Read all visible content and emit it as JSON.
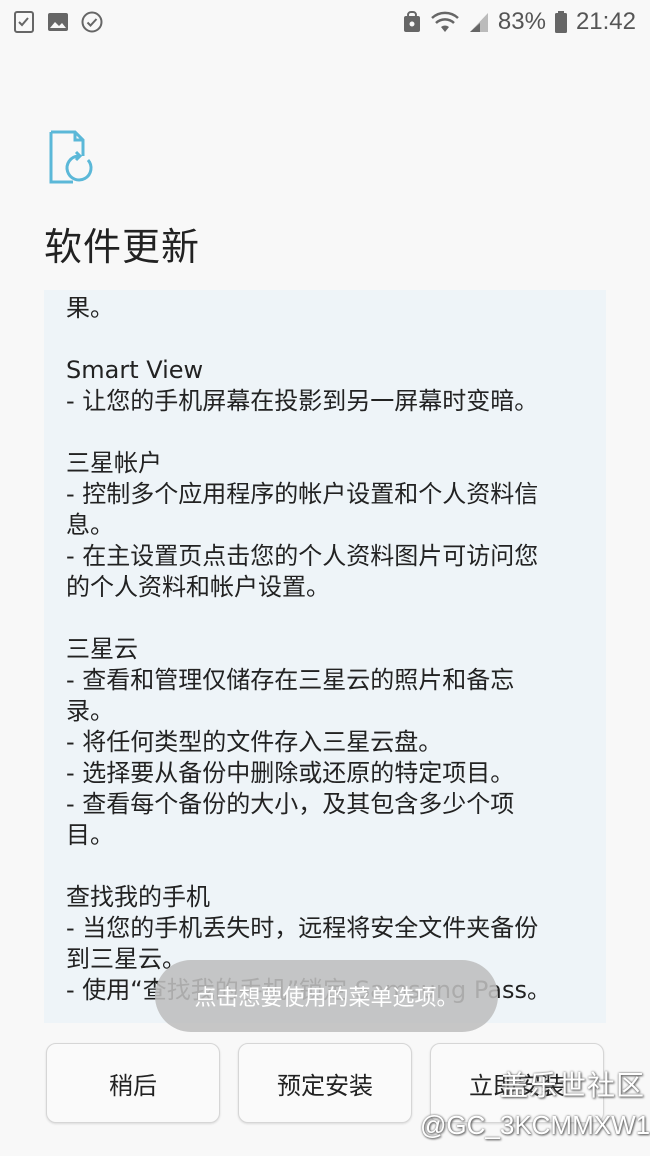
{
  "status_bar": {
    "battery_percent": "83%",
    "time": "21:42",
    "left_icons": [
      "checklist-icon",
      "gallery-icon",
      "check-circle-icon"
    ],
    "right_icons": [
      "secure-folder-icon",
      "wifi-icon",
      "signal-icon",
      "battery-icon"
    ]
  },
  "header": {
    "icon": "software-update-icon",
    "title": "软件更新"
  },
  "notes": {
    "lines": [
      "果。",
      "",
      "Smart View",
      "- 让您的手机屏幕在投影到另一屏幕时变暗。",
      "",
      "三星帐户",
      "- 控制多个应用程序的帐户设置和个人资料信",
      "息。",
      "- 在主设置页点击您的个人资料图片可访问您",
      "的个人资料和帐户设置。",
      "",
      "三星云",
      "- 查看和管理仅储存在三星云的照片和备忘",
      "录。",
      "- 将任何类型的文件存入三星云盘。",
      "- 选择要从备份中删除或还原的特定项目。",
      "- 查看每个备份的大小，及其包含多少个项",
      "目。",
      "",
      "查找我的手机",
      "- 当您的手机丢失时，远程将安全文件夹备份",
      "到三星云。",
      "- 使用“查找我的手机”锁定 Samsung Pass。"
    ]
  },
  "toast": {
    "text": "点击想要使用的菜单选项。"
  },
  "buttons": {
    "later": "稍后",
    "schedule": "预定安装",
    "install_now": "立即安装"
  },
  "watermark": {
    "community": "盖乐世社区",
    "user": "@GC_3KCMMXW1"
  },
  "colors": {
    "panel_bg": "#eef4f8",
    "accent_icon": "#5bb8d8",
    "page_bg": "#f8f8f8"
  }
}
